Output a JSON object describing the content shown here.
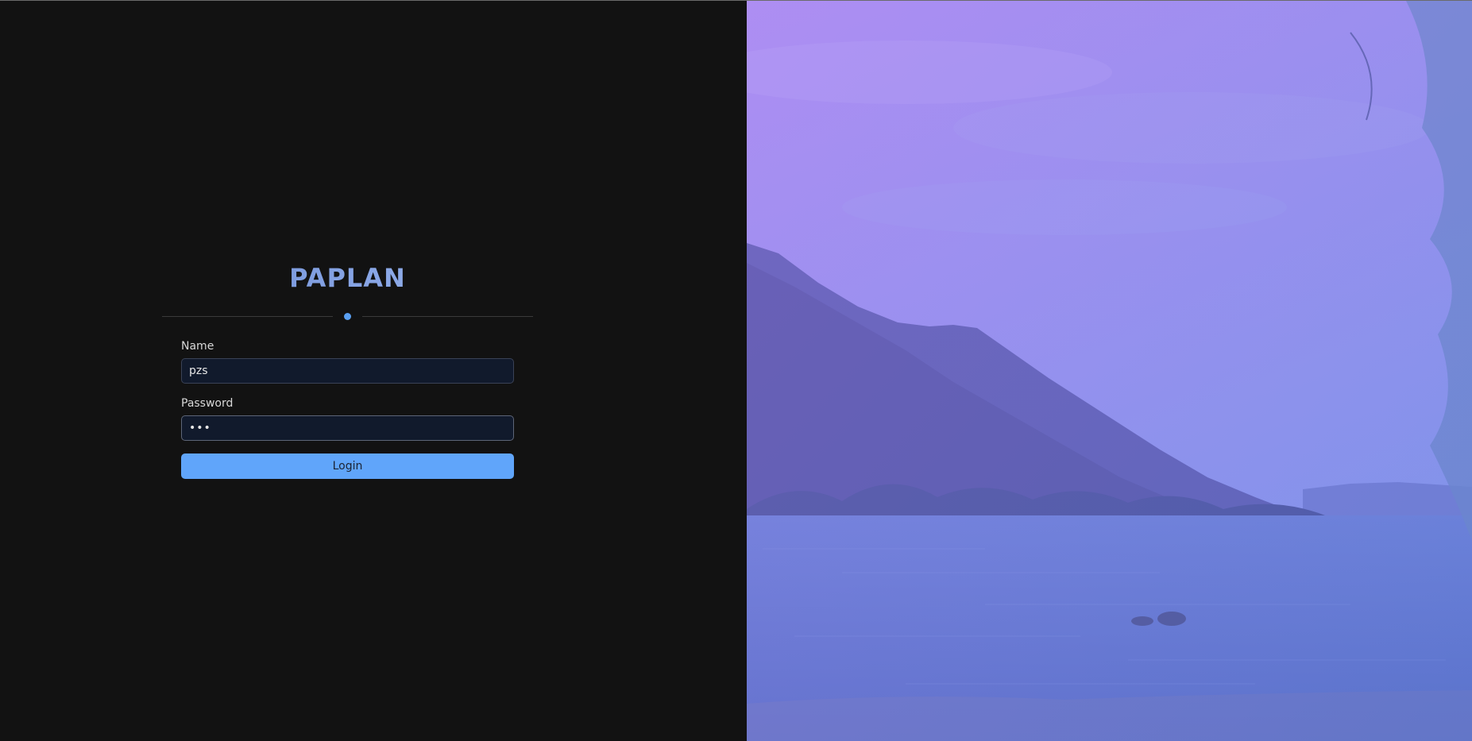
{
  "brand": {
    "title": "PAPLAN",
    "accent_color": "#60a5fa"
  },
  "form": {
    "name_label": "Name",
    "name_value": "pzs",
    "password_label": "Password",
    "password_value": "•••",
    "submit_label": "Login"
  },
  "background_image": {
    "icon": "landscape-photo",
    "tint_colors": [
      "#a88ef0",
      "#7b8fe8",
      "#5b79c9"
    ]
  }
}
